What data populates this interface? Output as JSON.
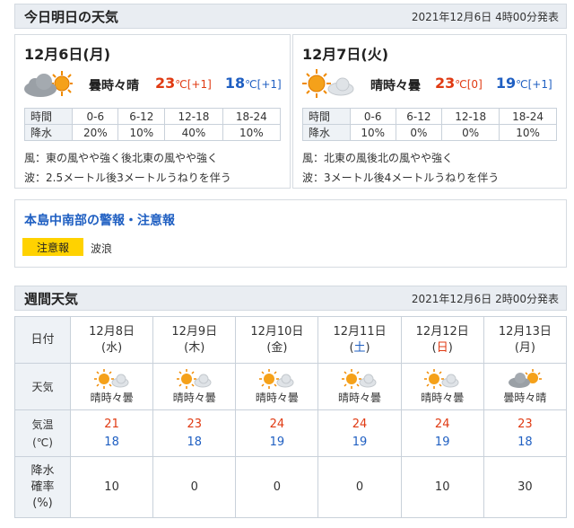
{
  "today_tomorrow": {
    "title": "今日明日の天気",
    "issued": "2021年12月6日 4時00分発表",
    "days": [
      {
        "date": "12月6日(月)",
        "weather_text": "曇時々晴",
        "icon": "cloudy-sometimes-sunny-icon",
        "high": "23",
        "high_diff": "[+1]",
        "low": "18",
        "low_diff": "[+1]",
        "rain_headers": [
          "時間",
          "0-6",
          "6-12",
          "12-18",
          "18-24"
        ],
        "rain_label": "降水",
        "rain_values": [
          "20%",
          "10%",
          "40%",
          "10%"
        ],
        "wind": "風：東の風やや強く後北東の風やや強く",
        "wave": "波：2.5メートル後3メートルうねりを伴う"
      },
      {
        "date": "12月7日(火)",
        "weather_text": "晴時々曇",
        "icon": "sunny-sometimes-cloudy-icon",
        "high": "23",
        "high_diff": "[0]",
        "low": "19",
        "low_diff": "[+1]",
        "rain_headers": [
          "時間",
          "0-6",
          "6-12",
          "12-18",
          "18-24"
        ],
        "rain_label": "降水",
        "rain_values": [
          "10%",
          "0%",
          "0%",
          "10%"
        ],
        "wind": "風：北東の風後北の風やや強く",
        "wave": "波：3メートル後4メートルうねりを伴う"
      }
    ],
    "unit": "℃"
  },
  "warnings": {
    "title": "本島中南部の警報・注意報",
    "badge": "注意報",
    "text": "波浪"
  },
  "weekly": {
    "title": "週間天気",
    "issued": "2021年12月6日 2時00分発表",
    "row_labels": {
      "date": "日付",
      "weather": "天気",
      "temp_line1": "気温",
      "temp_line2": "(℃)",
      "rain_line1": "降水",
      "rain_line2": "確率",
      "rain_line3": "(%)"
    },
    "days": [
      {
        "date": "12月8日",
        "dow": "(水)",
        "dow_type": "weekday",
        "icon": "sunny-sometimes-cloudy-icon",
        "weather": "晴時々曇",
        "high": "21",
        "low": "18",
        "rain": "10"
      },
      {
        "date": "12月9日",
        "dow": "(木)",
        "dow_type": "weekday",
        "icon": "sunny-sometimes-cloudy-icon",
        "weather": "晴時々曇",
        "high": "23",
        "low": "18",
        "rain": "0"
      },
      {
        "date": "12月10日",
        "dow": "(金)",
        "dow_type": "weekday",
        "icon": "sunny-sometimes-cloudy-icon",
        "weather": "晴時々曇",
        "high": "24",
        "low": "19",
        "rain": "0"
      },
      {
        "date": "12月11日",
        "dow": "(土)",
        "dow_type": "sat",
        "icon": "sunny-sometimes-cloudy-icon",
        "weather": "晴時々曇",
        "high": "24",
        "low": "19",
        "rain": "0"
      },
      {
        "date": "12月12日",
        "dow": "(日)",
        "dow_type": "sun",
        "icon": "sunny-sometimes-cloudy-icon",
        "weather": "晴時々曇",
        "high": "24",
        "low": "19",
        "rain": "10"
      },
      {
        "date": "12月13日",
        "dow": "(月)",
        "dow_type": "weekday",
        "icon": "cloudy-sometimes-sunny-icon",
        "weather": "曇時々晴",
        "high": "23",
        "low": "18",
        "rain": "30"
      }
    ]
  },
  "colors": {
    "high_temp": "#e03a12",
    "low_temp": "#1f5fc2",
    "warning_badge": "#ffd200",
    "header_bg": "#e9edf2"
  }
}
